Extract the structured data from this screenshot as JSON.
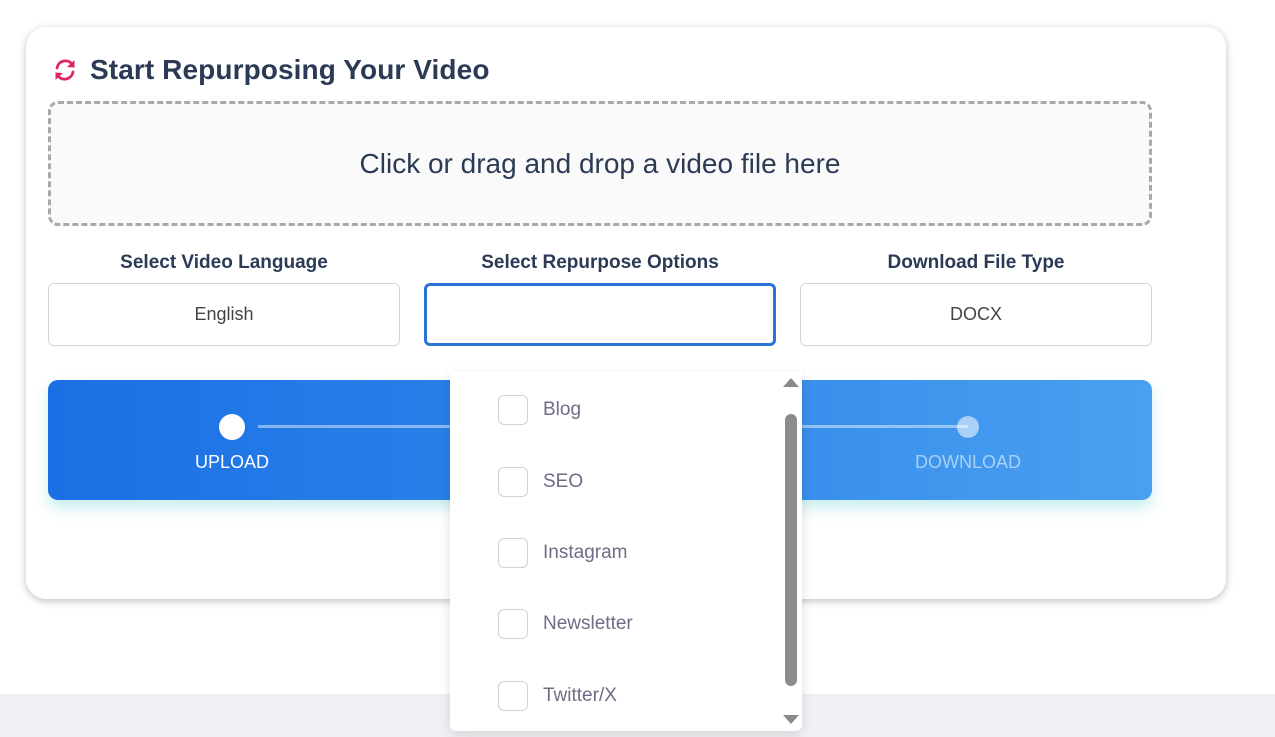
{
  "title": "Start Repurposing Your Video",
  "dropzone": {
    "text": "Click or drag and drop a video file here"
  },
  "fields": {
    "language": {
      "label": "Select Video Language",
      "value": "English"
    },
    "repurpose": {
      "label": "Select Repurpose Options",
      "value": ""
    },
    "filetype": {
      "label": "Download File Type",
      "value": "DOCX"
    }
  },
  "steps": [
    {
      "label": "UPLOAD",
      "active": true
    },
    {
      "label": "DOWNLOAD",
      "active": false
    }
  ],
  "options": [
    {
      "label": "Blog",
      "checked": false
    },
    {
      "label": "SEO",
      "checked": false
    },
    {
      "label": "Instagram",
      "checked": false
    },
    {
      "label": "Newsletter",
      "checked": false
    },
    {
      "label": "Twitter/X",
      "checked": false
    }
  ],
  "colors": {
    "accent": "#2a74d6",
    "icon": "#e0245e",
    "title": "#2b3a55",
    "option_text": "#6f6c86"
  },
  "icons": {
    "title_icon": "refresh-icon"
  }
}
